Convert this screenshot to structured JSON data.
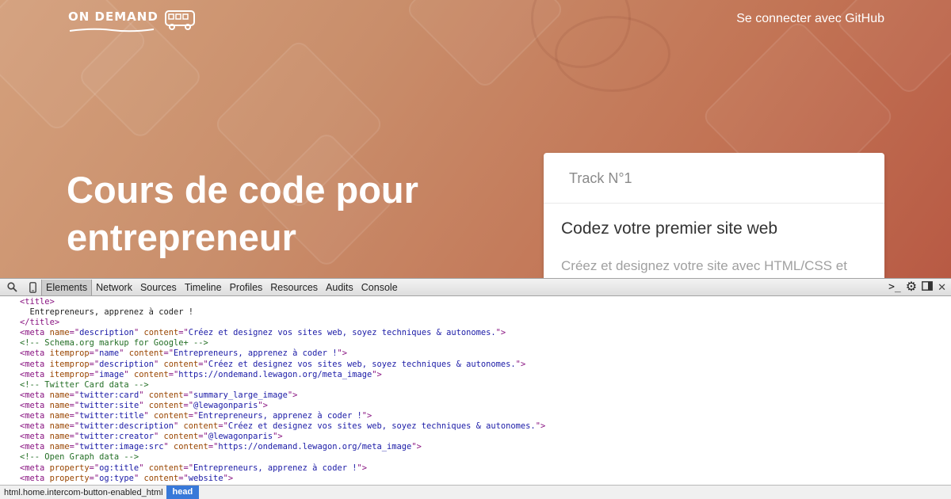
{
  "header": {
    "logo_text": "ON DEMAND",
    "logo_icon": "bus-icon",
    "login_link": "Se connecter avec GitHub"
  },
  "hero": {
    "title_line1": "Cours de code pour",
    "title_line2": "entrepreneur"
  },
  "track_card": {
    "track": "Track N°1",
    "title": "Codez votre premier site web",
    "description": "Créez et designez votre site avec HTML/CSS et"
  },
  "devtools": {
    "icons": [
      "search-icon",
      "device-icon",
      "console-drawer-icon",
      "settings-gear-icon",
      "dock-side-icon",
      "close-icon"
    ],
    "tabs": [
      "Elements",
      "Network",
      "Sources",
      "Timeline",
      "Profiles",
      "Resources",
      "Audits",
      "Console"
    ],
    "active_tab": "Elements",
    "code_lines": [
      {
        "kind": "tag",
        "indent": "    ",
        "text": "<title>"
      },
      {
        "kind": "text",
        "indent": "      ",
        "text": "Entrepreneurs, apprenez à coder !"
      },
      {
        "kind": "tag",
        "indent": "    ",
        "text": "</title>"
      },
      {
        "kind": "meta",
        "indent": "    ",
        "tag": "meta",
        "attrs": [
          [
            "name",
            "description"
          ],
          [
            "content",
            "Créez et designez vos sites web, soyez techniques & autonomes."
          ]
        ]
      },
      {
        "kind": "comment",
        "indent": "    ",
        "text": "<!-- Schema.org markup for Google+ -->"
      },
      {
        "kind": "meta",
        "indent": "    ",
        "tag": "meta",
        "attrs": [
          [
            "itemprop",
            "name"
          ],
          [
            "content",
            "Entrepreneurs, apprenez à coder !"
          ]
        ]
      },
      {
        "kind": "meta",
        "indent": "    ",
        "tag": "meta",
        "attrs": [
          [
            "itemprop",
            "description"
          ],
          [
            "content",
            "Créez et designez vos sites web, soyez techniques & autonomes."
          ]
        ]
      },
      {
        "kind": "meta",
        "indent": "    ",
        "tag": "meta",
        "attrs": [
          [
            "itemprop",
            "image"
          ],
          [
            "content",
            "https://ondemand.lewagon.org/meta_image"
          ]
        ]
      },
      {
        "kind": "comment",
        "indent": "    ",
        "text": "<!-- Twitter Card data -->"
      },
      {
        "kind": "meta",
        "indent": "    ",
        "tag": "meta",
        "attrs": [
          [
            "name",
            "twitter:card"
          ],
          [
            "content",
            "summary_large_image"
          ]
        ]
      },
      {
        "kind": "meta",
        "indent": "    ",
        "tag": "meta",
        "attrs": [
          [
            "name",
            "twitter:site"
          ],
          [
            "content",
            "@lewagonparis"
          ]
        ]
      },
      {
        "kind": "meta",
        "indent": "    ",
        "tag": "meta",
        "attrs": [
          [
            "name",
            "twitter:title"
          ],
          [
            "content",
            "Entrepreneurs, apprenez à coder !"
          ]
        ]
      },
      {
        "kind": "meta",
        "indent": "    ",
        "tag": "meta",
        "attrs": [
          [
            "name",
            "twitter:description"
          ],
          [
            "content",
            "Créez et designez vos sites web, soyez techniques & autonomes."
          ]
        ]
      },
      {
        "kind": "meta",
        "indent": "    ",
        "tag": "meta",
        "attrs": [
          [
            "name",
            "twitter:creator"
          ],
          [
            "content",
            "@lewagonparis"
          ]
        ]
      },
      {
        "kind": "meta",
        "indent": "    ",
        "tag": "meta",
        "attrs": [
          [
            "name",
            "twitter:image:src"
          ],
          [
            "content",
            "https://ondemand.lewagon.org/meta_image"
          ]
        ]
      },
      {
        "kind": "comment",
        "indent": "    ",
        "text": "<!-- Open Graph data -->"
      },
      {
        "kind": "meta",
        "indent": "    ",
        "tag": "meta",
        "attrs": [
          [
            "property",
            "og:title"
          ],
          [
            "content",
            "Entrepreneurs, apprenez à coder !"
          ]
        ]
      },
      {
        "kind": "meta",
        "indent": "    ",
        "tag": "meta",
        "attrs": [
          [
            "property",
            "og:type"
          ],
          [
            "content",
            "website"
          ]
        ]
      }
    ],
    "breadcrumbs": [
      "html.home.intercom-button-enabled_html",
      "head"
    ],
    "active_crumb": "head"
  },
  "colors": {
    "hero_start": "#d4a07c",
    "hero_end": "#b85a44",
    "devtools_tag": "#881280",
    "devtools_attr_name": "#994500",
    "devtools_attr_value": "#1a1aa6",
    "devtools_comment": "#236e25",
    "crumb_active": "#3879d9"
  }
}
